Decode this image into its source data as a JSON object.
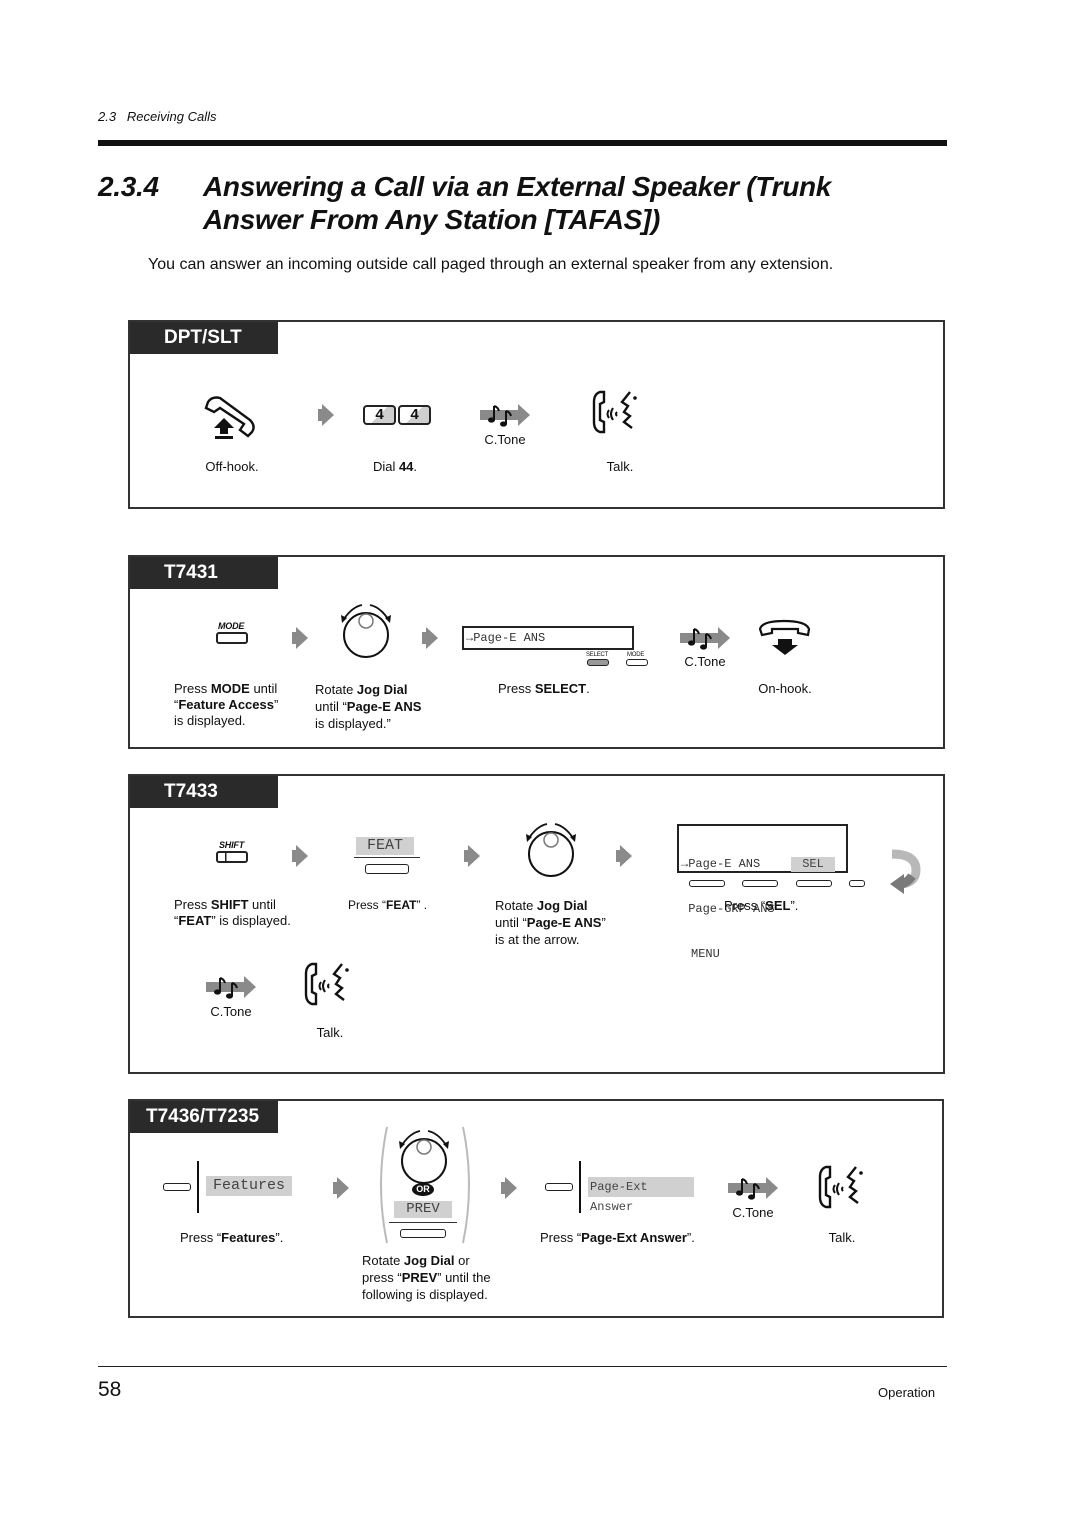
{
  "page": {
    "running_head": "2.3   Receiving Calls",
    "section_number": "2.3.4",
    "title_line1": "Answering a Call via an External Speaker (Trunk",
    "title_line2": "Answer From Any Station [TAFAS])",
    "intro": "You can answer an incoming outside call paged through an external speaker from any extension.",
    "page_number": "58",
    "footer_section": "Operation"
  },
  "panels": {
    "dpt_slt": {
      "tab": "DPT/SLT",
      "offhook": "Off-hook.",
      "dial_prefix": "Dial ",
      "dial_code": "44",
      "dial_suffix": ".",
      "keys": [
        "4",
        "4"
      ],
      "ctone": "C.Tone",
      "talk": "Talk."
    },
    "t7431": {
      "tab": "T7431",
      "mode_key_label": "MODE",
      "step1": {
        "a": "Press ",
        "b": "MODE",
        "c": " until",
        "d": "“",
        "e": "Feature Access",
        "f": "”",
        "g": "is displayed."
      },
      "step2": {
        "a": "Rotate ",
        "b": "Jog Dial",
        "c": "until “",
        "d": "Page-E ANS",
        "e": "is displayed.”"
      },
      "display_text": "→Page-E ANS",
      "select_label": "SELECT",
      "mode_label": "MODE",
      "step3": {
        "a": "Press ",
        "b": "SELECT",
        "c": "."
      },
      "ctone": "C.Tone",
      "onhook": "On-hook."
    },
    "t7433": {
      "tab": "T7433",
      "shift_key_label": "SHIFT",
      "feat_soft": "FEAT",
      "step1": {
        "a": "Press ",
        "b": "SHIFT",
        "c": " until",
        "d": "“",
        "e": "FEAT",
        "f": "” is displayed."
      },
      "step2": {
        "a": "Press “",
        "b": "FEAT",
        "c": "” ."
      },
      "step3": {
        "a": "Rotate ",
        "b": "Jog Dial",
        "c": "until “",
        "d": "Page-E ANS",
        "e": "”",
        "f": "is at the arrow."
      },
      "display_lines": [
        "→Page-E ANS",
        " Page-GRP ANS"
      ],
      "display_menu": "MENU",
      "display_sel": "SEL",
      "step4": {
        "a": "Press “",
        "b": "SEL",
        "c": "”."
      },
      "ctone": "C.Tone",
      "talk": "Talk."
    },
    "t7436": {
      "tab": "T7436/T7235",
      "features_soft": "Features",
      "step1": {
        "a": "Press “",
        "b": "Features",
        "c": "”."
      },
      "or_label": "OR",
      "prev_soft": "PREV",
      "step2": {
        "a": "Rotate ",
        "b": "Jog Dial",
        "c": " or",
        "d": "press “",
        "e": "PREV",
        "f": "” until the",
        "g": "following is displayed."
      },
      "page_ext_soft": "Page-Ext Answer",
      "step3": {
        "a": "Press “",
        "b": "Page-Ext Answer",
        "c": "”."
      },
      "ctone": "C.Tone",
      "talk": "Talk."
    }
  }
}
